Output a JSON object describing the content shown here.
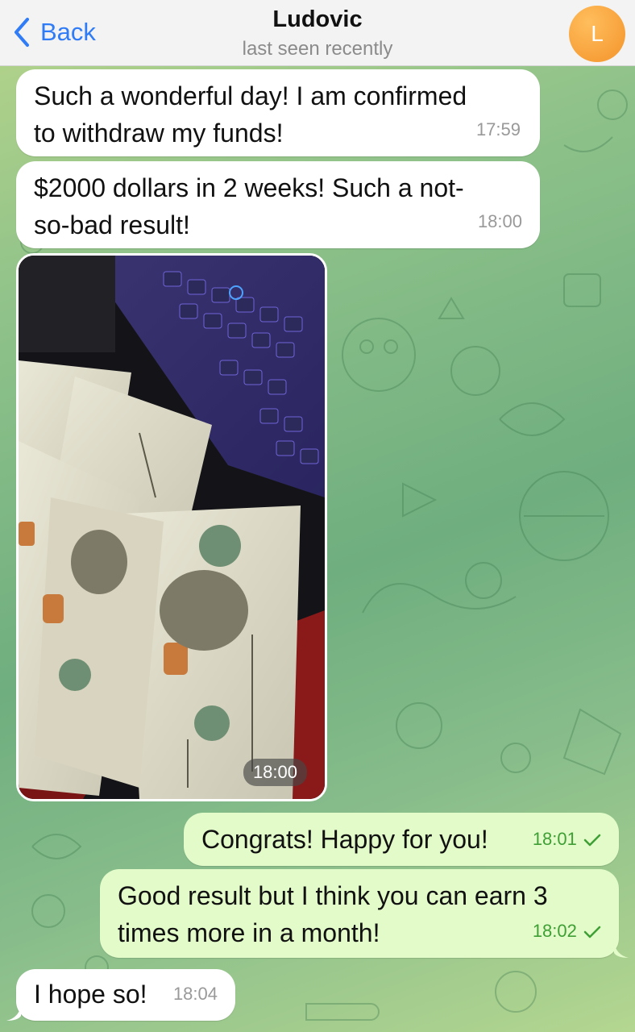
{
  "header": {
    "back_label": "Back",
    "contact_name": "Ludovic",
    "status": "last seen recently",
    "avatar_initial": "L",
    "avatar_color": "#f7a03a"
  },
  "messages": [
    {
      "direction": "in",
      "lines": [
        "Such a wonderful day! I am confirmed",
        "to withdraw my funds!"
      ],
      "time": "17:59"
    },
    {
      "direction": "in",
      "lines": [
        "$2000 dollars in 2 weeks! Such a not-",
        "so-bad result!"
      ],
      "time": "18:00"
    },
    {
      "direction": "in",
      "type": "photo",
      "time": "18:00"
    },
    {
      "direction": "out",
      "lines": [
        "Congrats! Happy for you!"
      ],
      "time": "18:01",
      "status": "sent"
    },
    {
      "direction": "out",
      "lines": [
        "Good result but I think you can earn 3",
        "times more in a month!"
      ],
      "time": "18:02",
      "status": "sent"
    },
    {
      "direction": "in",
      "lines": [
        "I hope so!"
      ],
      "time": "18:04"
    }
  ],
  "icons": {
    "back": "chevron-left-icon",
    "check": "check-icon"
  },
  "colors": {
    "accent": "#2f7cf6",
    "incoming_bubble": "#ffffff",
    "outgoing_bubble": "#e2fbc9",
    "outgoing_time": "#3f9f35"
  }
}
